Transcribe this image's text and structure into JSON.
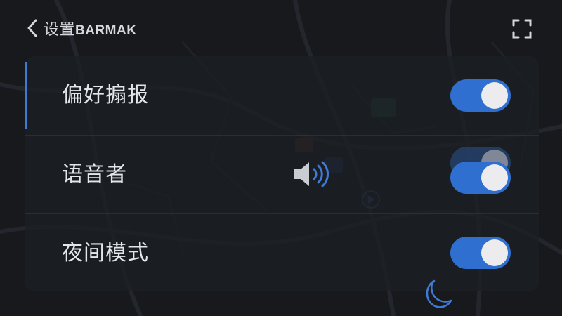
{
  "header": {
    "back_icon": "chevron-left-icon",
    "title_cn": "设置",
    "title_latin": "BARMAK",
    "fullscreen_icon": "fullscreen-icon"
  },
  "settings": [
    {
      "label": "偏好搧报",
      "enabled": true
    },
    {
      "label": "语音者",
      "enabled": true
    },
    {
      "label": "夜间模式",
      "enabled": true
    }
  ],
  "decor": {
    "speaker_icon": "speaker-volume-icon",
    "moon_icon": "moon-icon"
  },
  "colors": {
    "accent": "#2f6fd0",
    "background": "#17191d",
    "panel": "#1c1f24",
    "text": "#e4e6ea"
  }
}
